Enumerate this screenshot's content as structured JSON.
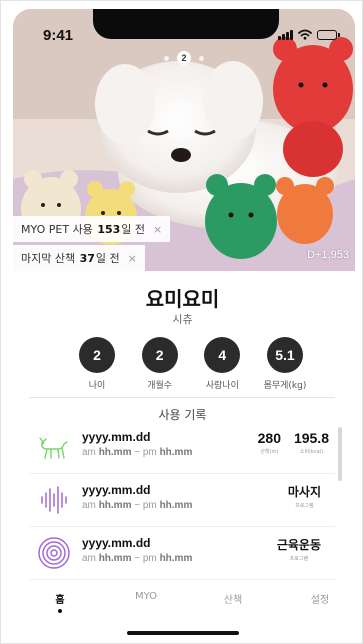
{
  "status_bar": {
    "time": "9:41"
  },
  "carousel": {
    "current_page": "2",
    "total_pages": 3
  },
  "hero": {
    "badge_usage": {
      "prefix": "MYO PET 사용",
      "count": "153",
      "suffix": "일 전",
      "close": "×"
    },
    "badge_walk": {
      "prefix": "마지막 산책",
      "count": "37",
      "suffix": "일 전",
      "close": "×"
    },
    "dday": "D+1,953"
  },
  "pet": {
    "name": "요미요미",
    "breed": "시츄"
  },
  "stats": [
    {
      "value": "2",
      "label": "나이"
    },
    {
      "value": "2",
      "label": "개월수"
    },
    {
      "value": "4",
      "label": "사람나이"
    },
    {
      "value": "5.1",
      "label": "몸무게(kg)"
    }
  ],
  "usage_section": {
    "title": "사용 기록",
    "rows": [
      {
        "icon": "dog-icon",
        "date": "yyyy.mm.dd",
        "time_am": "am",
        "time_start": "hh.mm",
        "time_sep": "~",
        "time_pm": "pm",
        "time_end": "hh.mm",
        "distance": "280",
        "distance_unit": "산책(m)",
        "calories": "195.8",
        "calories_unit": "소비(kcal)"
      },
      {
        "icon": "waveform-icon",
        "date": "yyyy.mm.dd",
        "time_am": "am",
        "time_start": "hh.mm",
        "time_sep": "~",
        "time_pm": "pm",
        "time_end": "hh.mm",
        "program": "마사지",
        "program_unit": "프로그램"
      },
      {
        "icon": "concentric-circles-icon",
        "date": "yyyy.mm.dd",
        "time_am": "am",
        "time_start": "hh.mm",
        "time_sep": "~",
        "time_pm": "pm",
        "time_end": "hh.mm",
        "program": "근육운동",
        "program_unit": "프로그램"
      }
    ]
  },
  "nav": [
    {
      "label": "홈",
      "active": true
    },
    {
      "label": "MYO",
      "active": false
    },
    {
      "label": "산책",
      "active": false
    },
    {
      "label": "설정",
      "active": false
    }
  ],
  "colors": {
    "dog_icon": "#7bd36b",
    "wave_icon": "#a770d6",
    "circles_icon": "#a06ad6",
    "stat_circle": "#2b2b2b"
  }
}
